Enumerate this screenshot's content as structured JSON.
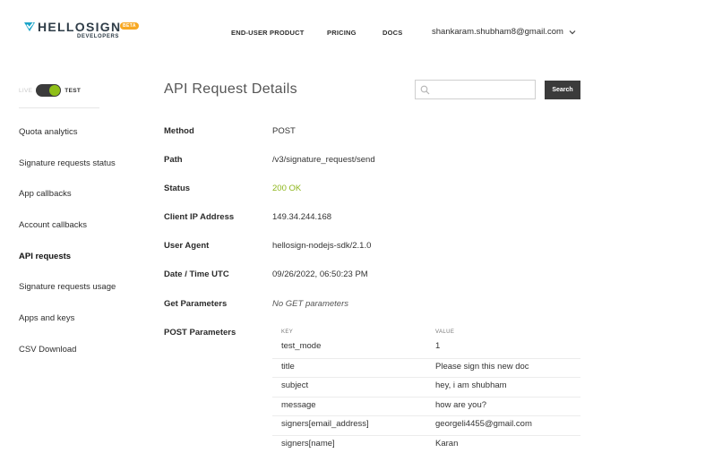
{
  "brand": {
    "name": "HELLOSIGN",
    "badge": "BETA",
    "sub": "DEVELOPERS",
    "accent_color": "#1ba4c9",
    "badge_color": "#f7a823"
  },
  "topnav": {
    "items": [
      "END-USER PRODUCT",
      "PRICING",
      "DOCS"
    ],
    "account_email": "shankaram.shubham8@gmail.com"
  },
  "env": {
    "live_label": "LIVE",
    "test_label": "TEST",
    "mode": "test"
  },
  "sidebar": {
    "items": [
      {
        "label": "Quota analytics"
      },
      {
        "label": "Signature requests status"
      },
      {
        "label": "App callbacks"
      },
      {
        "label": "Account callbacks"
      },
      {
        "label": "API requests"
      },
      {
        "label": "Signature requests usage"
      },
      {
        "label": "Apps and keys"
      },
      {
        "label": "CSV Download"
      }
    ],
    "active_index": 4
  },
  "main": {
    "title": "API Request Details",
    "search": {
      "value": "",
      "placeholder": "",
      "button_label": "Search"
    },
    "details": [
      {
        "label": "Method",
        "value": "POST"
      },
      {
        "label": "Path",
        "value": "/v3/signature_request/send"
      },
      {
        "label": "Status",
        "value": "200 OK"
      },
      {
        "label": "Client IP Address",
        "value": "149.34.244.168"
      },
      {
        "label": "User Agent",
        "value": "hellosign-nodejs-sdk/2.1.0"
      },
      {
        "label": "Date / Time UTC",
        "value": "09/26/2022, 06:50:23 PM"
      },
      {
        "label": "Get Parameters",
        "value": "No GET parameters"
      },
      {
        "label": "POST Parameters",
        "value": ""
      }
    ],
    "post_params": {
      "key_header": "KEY",
      "value_header": "VALUE",
      "rows": [
        {
          "key": "test_mode",
          "value": "1"
        },
        {
          "key": "title",
          "value": "Please sign this new doc"
        },
        {
          "key": "subject",
          "value": "hey, i am shubham"
        },
        {
          "key": "message",
          "value": "how are you?"
        },
        {
          "key": "signers[email_address]",
          "value": "georgeli4455@gmail.com"
        },
        {
          "key": "signers[name]",
          "value": "Karan"
        }
      ]
    }
  }
}
